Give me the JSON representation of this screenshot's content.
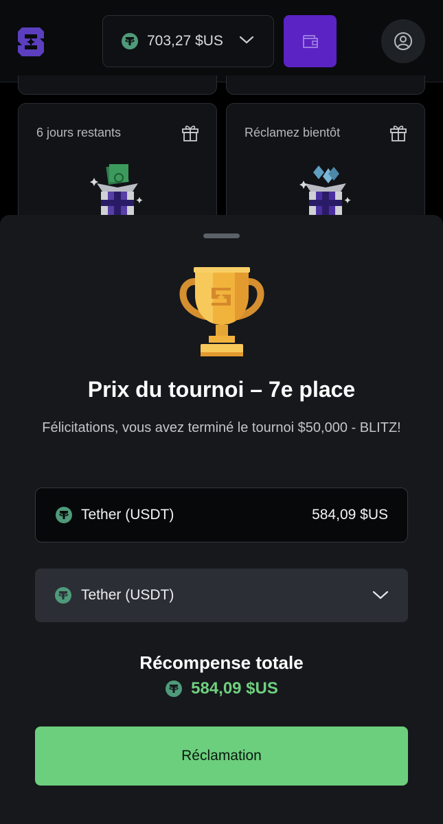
{
  "header": {
    "balance": "703,27 $US",
    "balance_token_icon": "tether-icon",
    "wallet_icon": "wallet-icon",
    "profile_icon": "user-icon"
  },
  "cards": [
    {
      "label": "6 jours restants",
      "icon": "gift-icon",
      "image": "cash-gift-box"
    },
    {
      "label": "Réclamez bientôt",
      "icon": "gift-icon",
      "image": "gem-gift-box"
    }
  ],
  "sheet": {
    "title": "Prix du tournoi – 7e place",
    "subtitle": "Félicitations, vous avez terminé le tournoi $50,000 - BLITZ!",
    "reward_row": {
      "token": "Tether (USDT)",
      "value": "584,09 $US"
    },
    "currency_select": {
      "selected": "Tether (USDT)"
    },
    "total_label": "Récompense totale",
    "total_value": "584,09 $US",
    "claim_label": "Réclamation"
  },
  "colors": {
    "accent_purple": "#5b22c4",
    "accent_green": "#6ccf7e",
    "tether_green": "#4e9a7a"
  }
}
